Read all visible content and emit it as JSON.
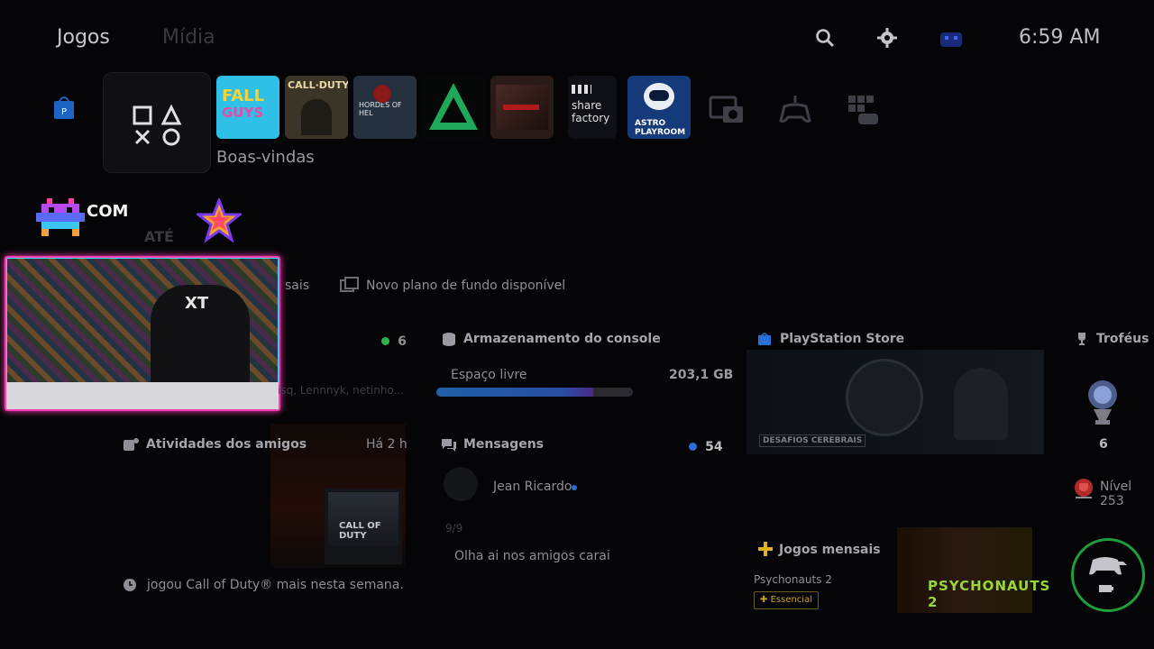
{
  "header": {
    "tab_games": "Jogos",
    "tab_media": "Mídia",
    "clock": "6:59 AM",
    "icons": [
      "search-icon",
      "gear-icon",
      "avatar"
    ]
  },
  "tiles": {
    "welcome_label": "Boas-vindas",
    "items": [
      {
        "name": "fall-guys",
        "label": "FALL GUYS",
        "color": "#2ec0e6"
      },
      {
        "name": "call-of-duty",
        "label": "CALL OF DUTY",
        "color": "#3a3526"
      },
      {
        "name": "hordes-of-hel",
        "label": "HORDES OF HEL",
        "color": "#263140"
      },
      {
        "name": "triangle-game",
        "label": "",
        "color": "#0b3a24"
      },
      {
        "name": "vampire-game",
        "label": "",
        "color": "#2a1a18"
      },
      {
        "name": "share-factory",
        "label": "share factory",
        "color": "#0f1116"
      },
      {
        "name": "astro-playroom",
        "label": "ASTRO PLAYROOM",
        "color": "#153a7a"
      }
    ]
  },
  "promo": {
    "com": "COM",
    "ate": "ATÉ"
  },
  "notice": {
    "partial_left": "sais",
    "text": "Novo plano de fundo disponível"
  },
  "friends_online": {
    "count": "6",
    "names": "isq, Lennnyk, netinho..."
  },
  "storage": {
    "title": "Armazenamento do console",
    "free_label": "Espaço livre",
    "free_value": "203,1 GB",
    "used_fraction": 0.8
  },
  "store": {
    "title": "PlayStation Store",
    "tag": "DESAFIOS CEREBRAIS",
    "tag_small": "DESAFIOS"
  },
  "trophies": {
    "title": "Troféus",
    "count": "6",
    "level": "Nível 253"
  },
  "friends_activity": {
    "title": "Atividades dos amigos",
    "time": "Há 2 h",
    "activity": "jogou Call of Duty® mais nesta semana.",
    "thumb_label": "CALL OF DUTY"
  },
  "messages": {
    "title": "Mensagens",
    "count": "54",
    "sender": "Jean Ricardo",
    "date": "9/9",
    "preview": "Olha ai nos amigos carai"
  },
  "monthly": {
    "title": "Jogos mensais",
    "game": "Psychonauts 2",
    "badge": "Essencial",
    "art_title": "PSYCHONAUTS 2"
  },
  "colors": {
    "accent_green": "#2db34a",
    "accent_blue": "#2a6fd6",
    "cam_border": "#ff3db6"
  }
}
